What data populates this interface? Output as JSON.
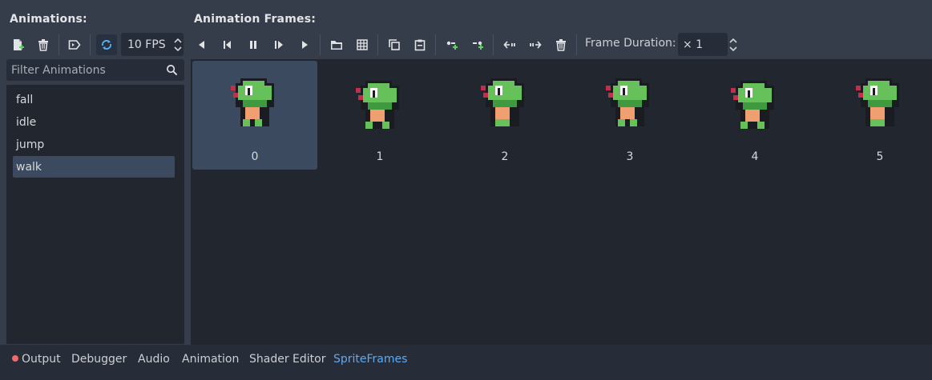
{
  "headers": {
    "animations": "Animations:",
    "frames": "Animation Frames:"
  },
  "fps": {
    "value": "10 FPS"
  },
  "frame_duration": {
    "label": "Frame Duration:",
    "value": "× 1"
  },
  "filter": {
    "placeholder": "Filter Animations",
    "icon": "search-icon"
  },
  "animations": [
    {
      "label": "fall"
    },
    {
      "label": "idle"
    },
    {
      "label": "jump"
    },
    {
      "label": "walk",
      "selected": true
    }
  ],
  "frames": [
    {
      "label": "0",
      "selected": true
    },
    {
      "label": "1"
    },
    {
      "label": "2"
    },
    {
      "label": "3"
    },
    {
      "label": "4"
    },
    {
      "label": "5"
    }
  ],
  "bottom_tabs": [
    {
      "label": "Output",
      "has_indicator": true
    },
    {
      "label": "Debugger"
    },
    {
      "label": "Audio"
    },
    {
      "label": "Animation"
    },
    {
      "label": "Shader Editor"
    },
    {
      "label": "SpriteFrames",
      "active": true
    }
  ],
  "colors": {
    "accent": "#63a9ee",
    "indicator": "#f06a6a",
    "selected": "#3b4a5e"
  }
}
